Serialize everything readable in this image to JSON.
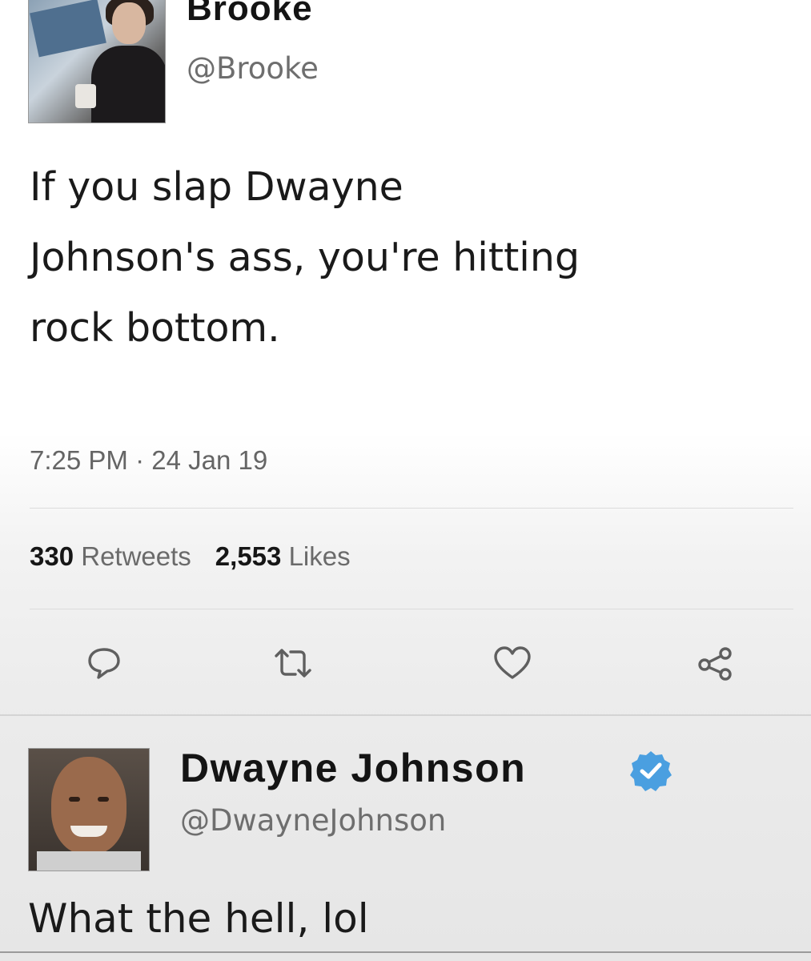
{
  "tweet": {
    "author": {
      "name": "Brooke",
      "handle": "@Brooke"
    },
    "text_lines": [
      "If you slap Dwayne",
      "Johnson's ass, you're hitting",
      "rock bottom."
    ],
    "timestamp": "7:25 PM · 24 Jan 19",
    "stats": {
      "retweets_count": "330",
      "retweets_label": "Retweets",
      "likes_count": "2,553",
      "likes_label": "Likes"
    },
    "actions": [
      {
        "name": "reply",
        "icon": "speech-bubble-icon"
      },
      {
        "name": "retweet",
        "icon": "retweet-icon"
      },
      {
        "name": "like",
        "icon": "heart-icon"
      },
      {
        "name": "share",
        "icon": "share-icon"
      }
    ]
  },
  "reply": {
    "author": {
      "name": "Dwayne Johnson",
      "handle": "@DwayneJohnson",
      "verified": true
    },
    "text": "What the hell, lol"
  },
  "colors": {
    "text_primary": "#141414",
    "text_secondary": "#6e6e6e",
    "verified_blue": "#4a9fe0",
    "icon_gray": "#5f5f5f"
  }
}
